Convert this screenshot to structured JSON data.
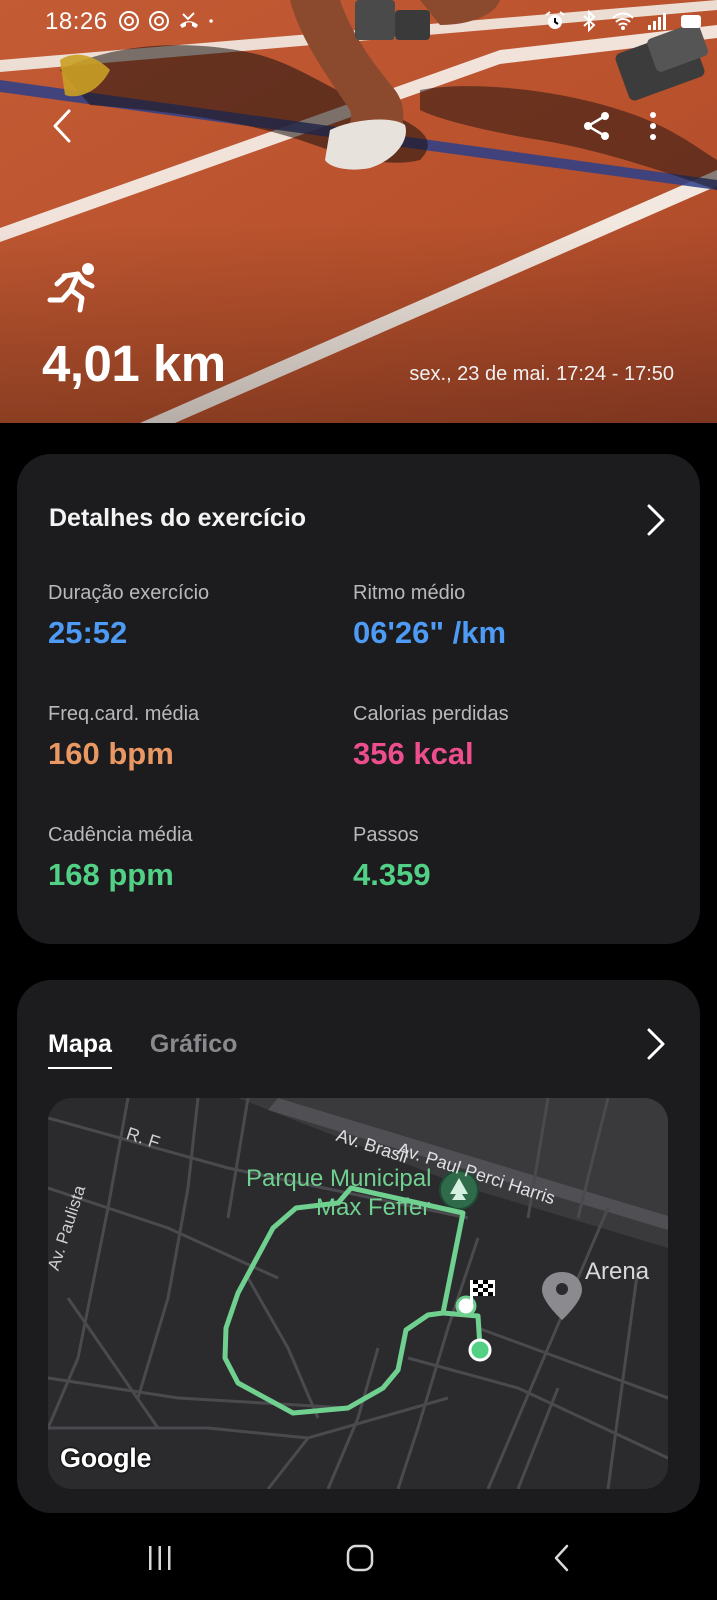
{
  "status_bar": {
    "time": "18:26",
    "left_icons": [
      "threads-icon",
      "threads-icon",
      "missed-call-icon",
      "dot-icon"
    ],
    "right_icons": [
      "alarm-icon",
      "bluetooth-icon",
      "wifi-icon",
      "signal-icon",
      "battery-icon"
    ]
  },
  "header": {
    "back_icon": "back-arrow-icon",
    "share_icon": "share-icon",
    "more_icon": "more-vertical-icon"
  },
  "hero": {
    "activity_icon": "running-icon",
    "distance": "4,01 km",
    "datetime": "sex., 23 de mai. 17:24 - 17:50"
  },
  "details": {
    "title": "Detalhes do exercício",
    "metrics": [
      {
        "label": "Duração exercício",
        "value": "25:52",
        "color": "#4d9bf5"
      },
      {
        "label": "Ritmo médio",
        "value": "06'26\" /km",
        "color": "#4d9bf5"
      },
      {
        "label": "Freq.card. média",
        "value": "160 bpm",
        "color": "#ea9863"
      },
      {
        "label": "Calorias perdidas",
        "value": "356 kcal",
        "color": "#ee4e8e"
      },
      {
        "label": "Cadência média",
        "value": "168 ppm",
        "color": "#52d186"
      },
      {
        "label": "Passos",
        "value": "4.359",
        "color": "#52d186"
      }
    ]
  },
  "map_card": {
    "tabs": [
      "Mapa",
      "Gráfico"
    ],
    "active_tab": "Mapa",
    "map": {
      "street_labels": [
        "R. F",
        "Av. Brasil",
        "Av. Paul Perci Harris",
        "Av. Paulista"
      ],
      "place_labels": [
        "Parque Municipal",
        "Max Feffer",
        "Arena"
      ],
      "attribution": "Google",
      "route_color": "#6fd08f"
    }
  },
  "nav_bar": {
    "recents_icon": "recents-icon",
    "home_icon": "home-icon",
    "back_icon": "nav-back-icon"
  }
}
